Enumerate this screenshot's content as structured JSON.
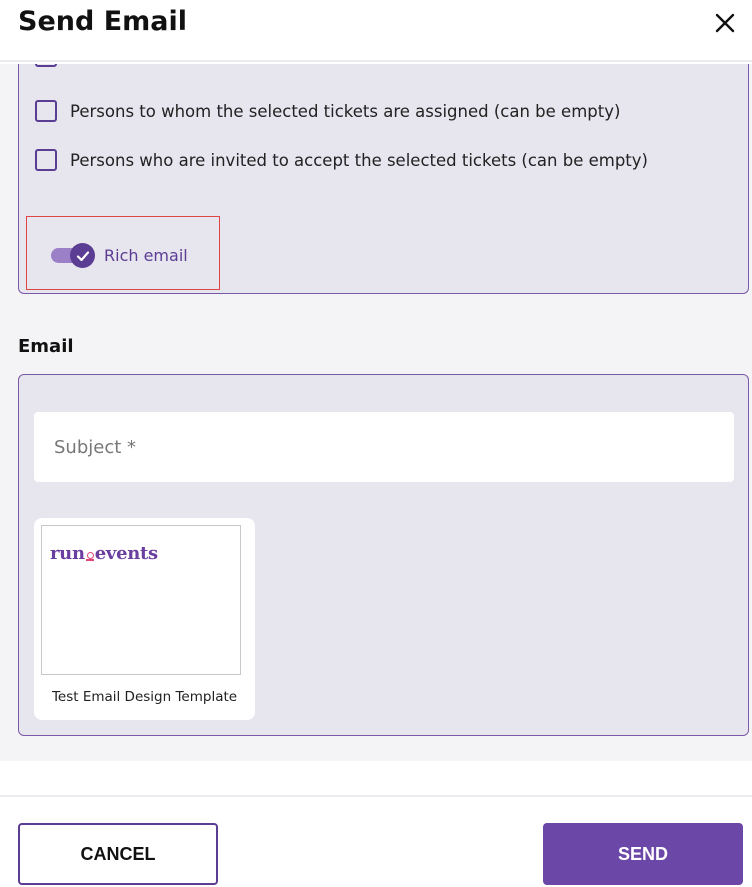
{
  "dialog": {
    "title": "Send Email",
    "close_icon": "close-icon"
  },
  "recipients": {
    "options": [
      {
        "label": "Persons to whom the selected tickets are assigned (can be empty)",
        "checked": false
      },
      {
        "label": "Persons who are invited to accept the selected tickets (can be empty)",
        "checked": false
      }
    ],
    "rich_email": {
      "label": "Rich email",
      "enabled": true
    }
  },
  "email": {
    "section_title": "Email",
    "subject_placeholder": "Subject *",
    "subject_value": "",
    "template": {
      "name": "Test Email Design Template",
      "logo_text_left": "run",
      "logo_text_right": "events"
    }
  },
  "footer": {
    "cancel_label": "CANCEL",
    "send_label": "SEND"
  },
  "colors": {
    "accent": "#5b3d94",
    "send_button": "#6b47a8",
    "panel_bg": "#e7e5ee",
    "highlight_border": "#e04545"
  }
}
